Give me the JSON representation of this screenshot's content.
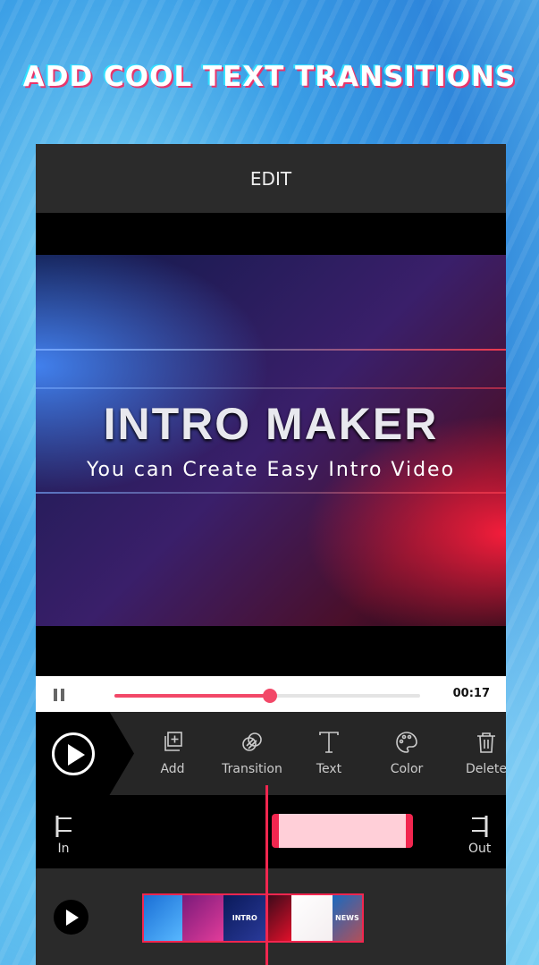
{
  "headline": "ADD COOL TEXT TRANSITIONS",
  "topbar": {
    "title": "EDIT"
  },
  "video": {
    "title": "INTRO MAKER",
    "subtitle": "You can Create Easy Intro Video"
  },
  "player": {
    "time": "00:17",
    "progress": 0.51,
    "state": "playing"
  },
  "toolbar": {
    "items": [
      {
        "label": "Add",
        "icon": "add-layer-icon"
      },
      {
        "label": "Transition",
        "icon": "transition-icon"
      },
      {
        "label": "Text",
        "icon": "text-icon"
      },
      {
        "label": "Color",
        "icon": "palette-icon"
      },
      {
        "label": "Delete",
        "icon": "trash-icon"
      }
    ]
  },
  "timeline": {
    "in_label": "In",
    "out_label": "Out",
    "range_start": 0.5,
    "range_end": 0.8
  },
  "thumbnails": [
    {
      "label": "",
      "colors": [
        "#1a6fd6",
        "#58b8ff"
      ]
    },
    {
      "label": "",
      "colors": [
        "#7a1a7a",
        "#e23c9a"
      ]
    },
    {
      "label": "INTRO",
      "colors": [
        "#0a1a5a",
        "#2a3a9a"
      ]
    },
    {
      "label": "",
      "colors": [
        "#3a0a1a",
        "#e0102a"
      ]
    },
    {
      "label": "",
      "colors": [
        "#ffffff",
        "#f4eef0"
      ]
    },
    {
      "label": "NEWS",
      "colors": [
        "#1a6abf",
        "#b0505a"
      ]
    }
  ],
  "colors": {
    "accent": "#f2264f",
    "progress": "#f24868",
    "range_fill": "#ffcfd8",
    "toolbar_bg": "#262626"
  }
}
